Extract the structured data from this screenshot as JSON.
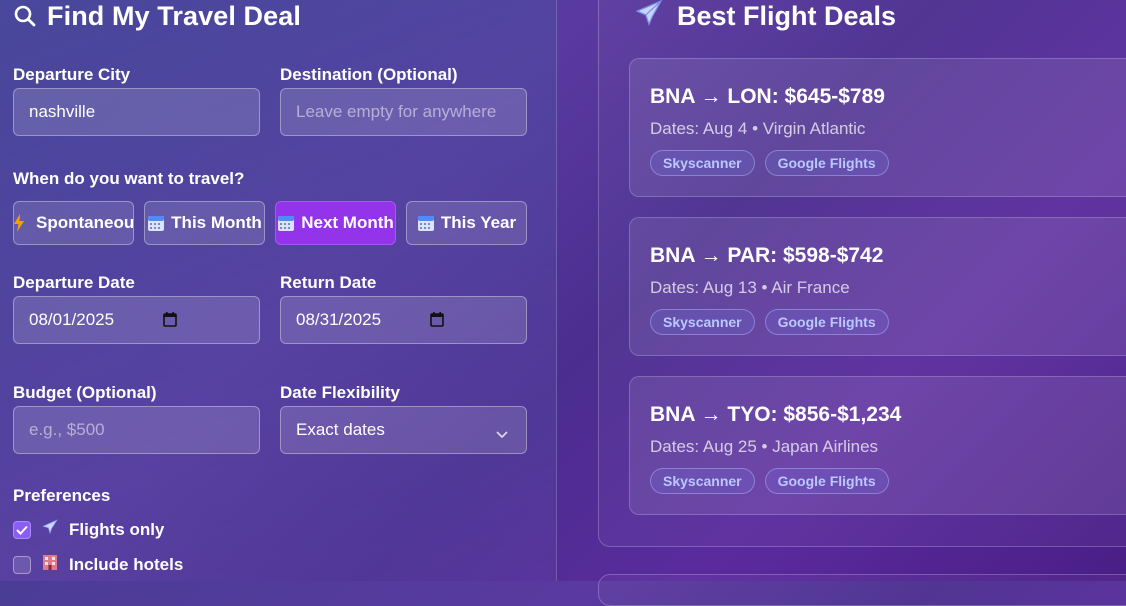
{
  "left": {
    "title": "Find My Travel Deal",
    "departure_city": {
      "label": "Departure City",
      "value": "nashville"
    },
    "destination": {
      "label": "Destination (Optional)",
      "placeholder": "Leave empty for anywhere"
    },
    "when_label": "When do you want to travel?",
    "timeframes": [
      {
        "label": "Spontaneous",
        "icon": "lightning-icon",
        "active": false
      },
      {
        "label": "This Month",
        "icon": "calendar-icon",
        "active": false
      },
      {
        "label": "Next Month",
        "icon": "calendar-icon",
        "active": true
      },
      {
        "label": "This Year",
        "icon": "calendar-icon",
        "active": false
      }
    ],
    "departure_date": {
      "label": "Departure Date",
      "value": "08/01/2025"
    },
    "return_date": {
      "label": "Return Date",
      "value": "08/31/2025"
    },
    "budget": {
      "label": "Budget (Optional)",
      "placeholder": "e.g., $500"
    },
    "flexibility": {
      "label": "Date Flexibility",
      "value": "Exact dates"
    },
    "preferences": {
      "label": "Preferences",
      "options": [
        {
          "label": "Flights only",
          "icon": "airplane-icon",
          "checked": true
        },
        {
          "label": "Include hotels",
          "icon": "hotel-icon",
          "checked": false
        }
      ]
    }
  },
  "right": {
    "title": "Best Flight Deals",
    "deals": [
      {
        "route": "BNA → LON: $645-$789",
        "meta": "Dates: Aug 4 • Virgin Atlantic",
        "link1": "Skyscanner",
        "link2": "Google Flights"
      },
      {
        "route": "BNA → PAR: $598-$742",
        "meta": "Dates: Aug 13 • Air France",
        "link1": "Skyscanner",
        "link2": "Google Flights"
      },
      {
        "route": "BNA → TYO: $856-$1,234",
        "meta": "Dates: Aug 25 • Japan Airlines",
        "link1": "Skyscanner",
        "link2": "Google Flights"
      }
    ]
  },
  "colors": {
    "accent": "#9333ea",
    "checkbox": "#8b5cf6",
    "link": "#b9c8ff"
  }
}
